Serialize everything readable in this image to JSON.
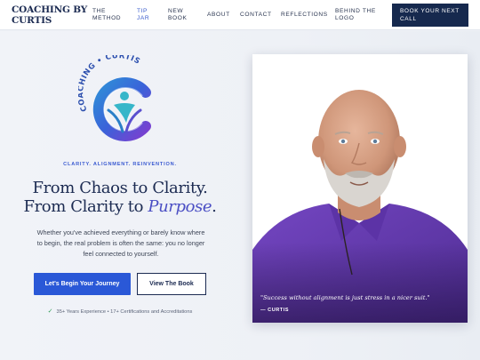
{
  "header": {
    "logo_line1": "COACHING BY",
    "logo_line2": "CURTIS",
    "nav": [
      {
        "line1": "THE",
        "line2": "METHOD"
      },
      {
        "line1": "TIP",
        "line2": "JAR"
      },
      {
        "line1": "NEW",
        "line2": "BOOK"
      },
      {
        "line1": "ABOUT",
        "line2": ""
      },
      {
        "line1": "CONTACT",
        "line2": ""
      },
      {
        "line1": "REFLECTIONS",
        "line2": ""
      },
      {
        "line1": "BEHIND THE",
        "line2": "LOGO"
      }
    ],
    "cta_line1": "BOOK YOUR NEXT",
    "cta_line2": "CALL"
  },
  "emblem": {
    "arc_text": "COACHING • CURTIS",
    "colors": {
      "blue": "#3a63d9",
      "purple": "#7b3fd0",
      "teal": "#36b6c9"
    }
  },
  "hero": {
    "tagline": "CLARITY. ALIGNMENT. REINVENTION.",
    "headline_line1": "From Chaos to Clarity.",
    "headline_line2_prefix": "From Clarity to ",
    "headline_emphasis": "Purpose",
    "headline_suffix": ".",
    "subtext_line1": "Whether you've achieved everything or barely know where",
    "subtext_line2": "to begin, the real problem is often the same: you no longer",
    "subtext_line3": "feel connected to yourself.",
    "primary_button": "Let's Begin Your Journey",
    "secondary_button": "View The Book",
    "trust": "35+ Years Experience • 17+ Certifications and Accreditations"
  },
  "photo": {
    "quote": "\"Success without alignment is just stress in a nicer suit.\"",
    "author": "— CURTIS"
  },
  "colors": {
    "navy": "#16294e",
    "accent_blue": "#2a58d7",
    "purpose_purple": "#4b4fc4",
    "shirt_purple": "#6a3fb5"
  }
}
